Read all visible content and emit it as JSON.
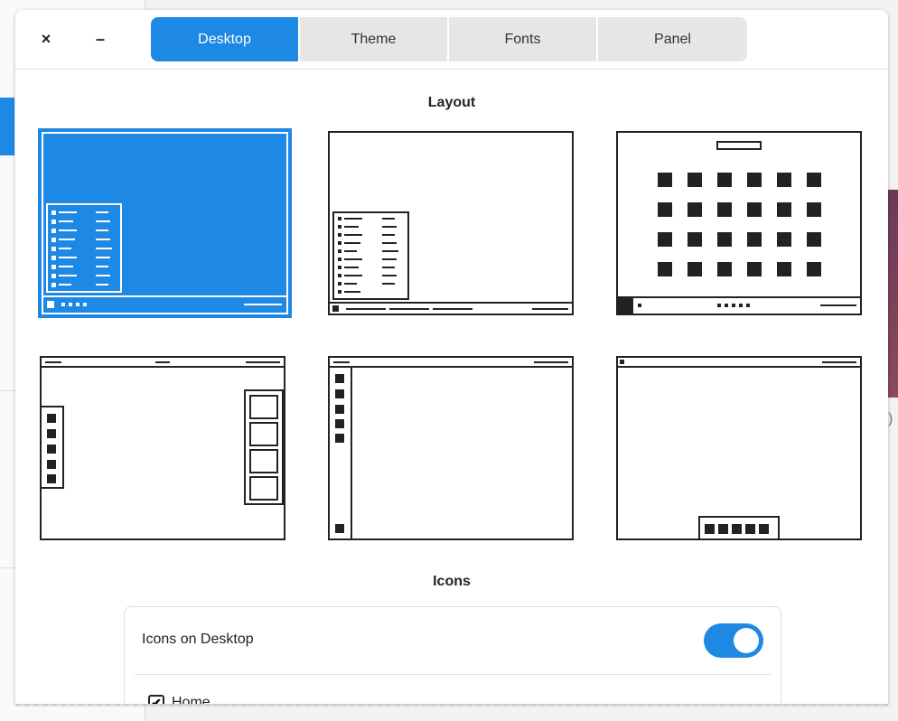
{
  "window": {
    "close_label": "×",
    "minimize_label": "–"
  },
  "tabs": [
    {
      "label": "Desktop",
      "active": true
    },
    {
      "label": "Theme",
      "active": false
    },
    {
      "label": "Fonts",
      "active": false
    },
    {
      "label": "Panel",
      "active": false
    }
  ],
  "layout_section": {
    "title": "Layout",
    "options": [
      {
        "name": "traditional-bottom-panel",
        "selected": true
      },
      {
        "name": "bottom-panel-menu",
        "selected": false
      },
      {
        "name": "app-grid-bottom-panel",
        "selected": false
      },
      {
        "name": "top-panel-side-docks",
        "selected": false
      },
      {
        "name": "top-panel-left-dock",
        "selected": false
      },
      {
        "name": "top-panel-bottom-dock",
        "selected": false
      }
    ]
  },
  "icons_section": {
    "title": "Icons",
    "icons_on_desktop_label": "Icons on Desktop",
    "icons_on_desktop_enabled": true,
    "home_label": "Home",
    "home_checked": true
  },
  "colors": {
    "accent": "#1e88e5"
  }
}
